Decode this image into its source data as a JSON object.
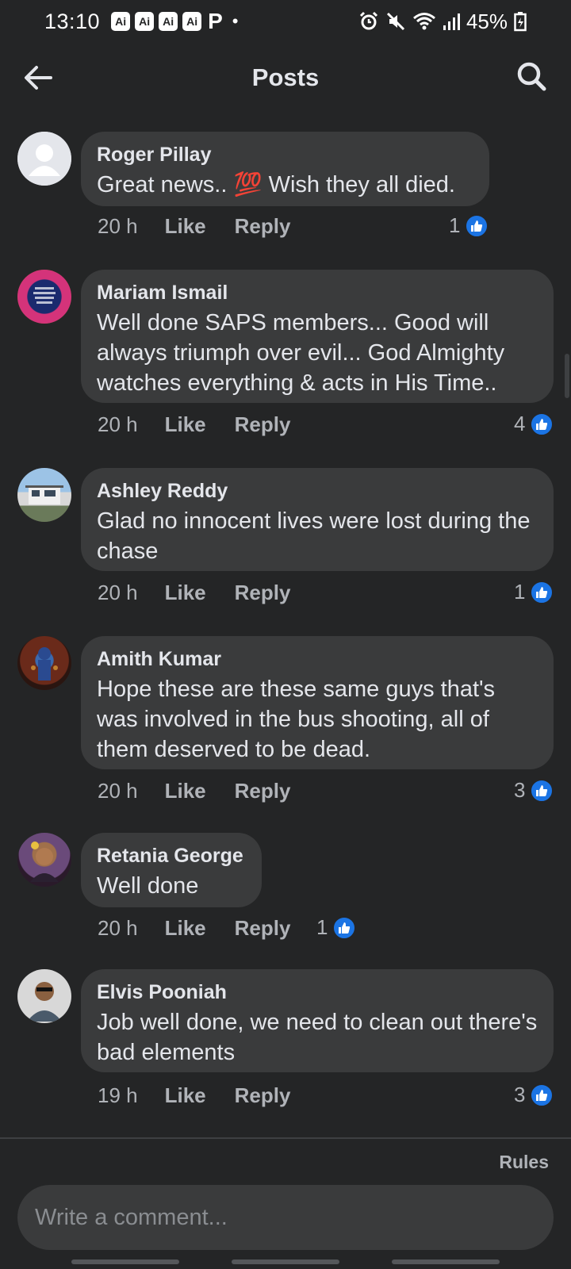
{
  "status_bar": {
    "time": "13:10",
    "ai_badges": [
      "Ai",
      "Ai",
      "Ai",
      "Ai"
    ],
    "p_glyph": "P",
    "dot": "•",
    "battery": "45%",
    "icons": [
      "alarm-icon",
      "mute-icon",
      "wifi-icon",
      "signal-icon",
      "battery-icon"
    ]
  },
  "header": {
    "title": "Posts",
    "icons": [
      "back-arrow-icon",
      "search-icon"
    ]
  },
  "comments": [
    {
      "name": "Roger Pillay",
      "text": "Great news.. 💯 Wish they all died.",
      "time": "20 h",
      "like": "Like",
      "reply": "Reply",
      "reactions": "1"
    },
    {
      "name": "Mariam Ismail",
      "text": "Well done SAPS members... Good will always triumph over evil... God Almighty watches everything & acts in His Time..",
      "time": "20 h",
      "like": "Like",
      "reply": "Reply",
      "reactions": "4"
    },
    {
      "name": "Ashley Reddy",
      "text": "Glad no innocent lives were lost during the chase",
      "time": "20 h",
      "like": "Like",
      "reply": "Reply",
      "reactions": "1"
    },
    {
      "name": "Amith Kumar",
      "text": "Hope these are these same guys that's was involved in the bus shooting,  all of them deserved to be dead.",
      "time": "20 h",
      "like": "Like",
      "reply": "Reply",
      "reactions": "3"
    },
    {
      "name": "Retania George",
      "text": "Well done",
      "time": "20 h",
      "like": "Like",
      "reply": "Reply",
      "reactions": "1"
    },
    {
      "name": "Elvis Pooniah",
      "text": "Job well done, we need to clean out there's bad elements",
      "time": "19 h",
      "like": "Like",
      "reply": "Reply",
      "reactions": "3"
    }
  ],
  "footer": {
    "rules": "Rules",
    "comment_placeholder": "Write a comment..."
  },
  "colors": {
    "background": "#242526",
    "bubble": "#3a3b3c",
    "like_blue": "#1b74e4",
    "secondary_text": "#b0b3b8"
  }
}
